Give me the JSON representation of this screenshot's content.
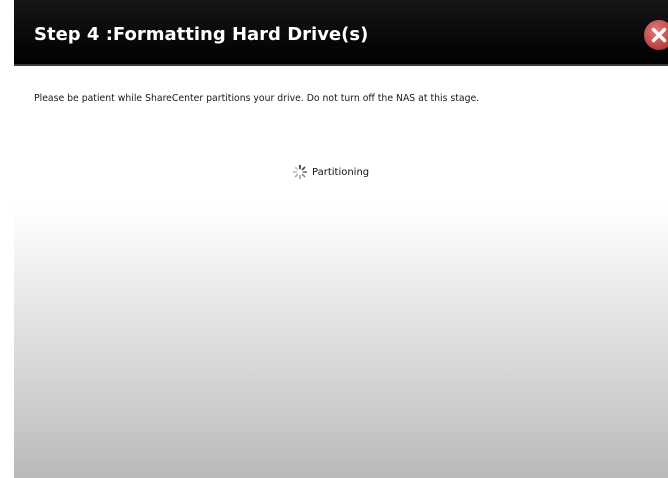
{
  "dialog": {
    "title": "Step 4 :Formatting Hard Drive(s)",
    "close_icon": "close-icon",
    "message": "Please be patient while ShareCenter partitions your drive. Do not turn off the NAS at this stage.",
    "status": {
      "icon": "loading-spinner-icon",
      "text": "Partitioning"
    }
  },
  "colors": {
    "title_bar": "#000000",
    "title_text": "#ffffff",
    "close_button": "#c44a4a"
  }
}
